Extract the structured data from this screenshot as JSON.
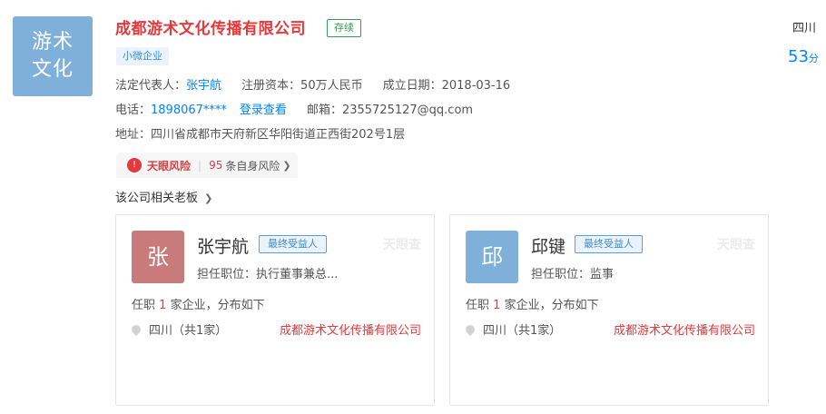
{
  "company": {
    "logo_lines": [
      "游术",
      "文化"
    ],
    "name": "成都游术文化传播有限公司",
    "status": "存续",
    "tag": "小微企业",
    "legal_rep_label": "法定代表人：",
    "legal_rep": "张宇航",
    "capital_label": "注册资本：",
    "capital": "50万人民币",
    "founded_label": "成立日期：",
    "founded": "2018-03-16",
    "phone_label": "电话：",
    "phone": "1898067****",
    "login_view": "登录查看",
    "email_label": "邮箱：",
    "email": "2355725127@qq.com",
    "address_label": "地址：",
    "address": "四川省成都市天府新区华阳街道正西街202号1层",
    "region": "四川",
    "score": "53",
    "score_unit": "分"
  },
  "risk": {
    "label": "天眼风险",
    "count": "95",
    "text": "条自身风险"
  },
  "bosses_title": "该公司相关老板",
  "bosses": [
    {
      "avatar": "张",
      "avatar_color": "#c97b7b",
      "name": "张宇航",
      "badge": "最终受益人",
      "watermark": "天眼查",
      "position": "担任职位：执行董事兼总...",
      "serve_prefix": "任职",
      "serve_count": "1",
      "serve_suffix": "家企业，分布如下",
      "region": "四川（共1家）",
      "company": "成都游术文化传播有限公司"
    },
    {
      "avatar": "邱",
      "avatar_color": "#7fb0d9",
      "name": "邱键",
      "badge": "最终受益人",
      "watermark": "天眼查",
      "position": "担任职位：监事",
      "serve_prefix": "任职",
      "serve_count": "1",
      "serve_suffix": "家企业，分布如下",
      "region": "四川（共1家）",
      "company": "成都游术文化传播有限公司"
    }
  ]
}
